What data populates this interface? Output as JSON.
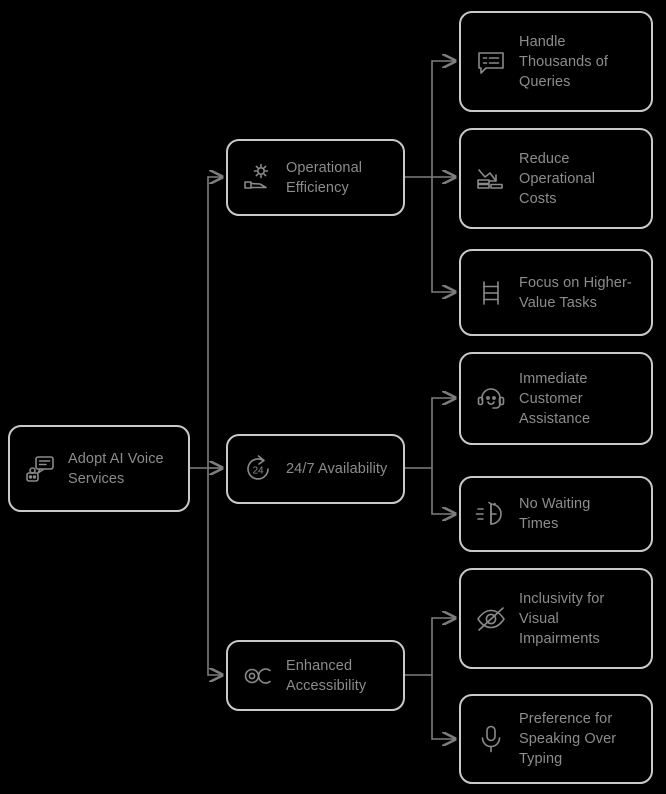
{
  "diagram": {
    "background_color": "#000000",
    "node_border_color": "#c9c9c9",
    "text_color": "#8c8c8c",
    "edge_color": "#7d7d7d",
    "root": {
      "label": "Adopt AI Voice\nServices",
      "icon": "robot-chat-icon"
    },
    "branches": [
      {
        "label": "Operational\nEfficiency",
        "icon": "gear-hand-icon",
        "children": [
          {
            "label": "Handle\nThousands of\nQueries",
            "icon": "chat-message-icon"
          },
          {
            "label": "Reduce\nOperational\nCosts",
            "icon": "cost-decrease-icon"
          },
          {
            "label": "Focus on Higher-\nValue Tasks",
            "icon": "ladder-icon"
          }
        ]
      },
      {
        "label": "24/7 Availability",
        "icon": "twenty-four-hours-icon",
        "children": [
          {
            "label": "Immediate\nCustomer\nAssistance",
            "icon": "headset-support-icon"
          },
          {
            "label": "No Waiting\nTimes",
            "icon": "fast-clock-icon"
          }
        ]
      },
      {
        "label": "Enhanced\nAccessibility",
        "icon": "accessibility-icon",
        "children": [
          {
            "label": "Inclusivity for\nVisual\nImpairments",
            "icon": "eye-off-icon"
          },
          {
            "label": "Preference for\nSpeaking Over\nTyping",
            "icon": "microphone-icon"
          }
        ]
      }
    ]
  }
}
